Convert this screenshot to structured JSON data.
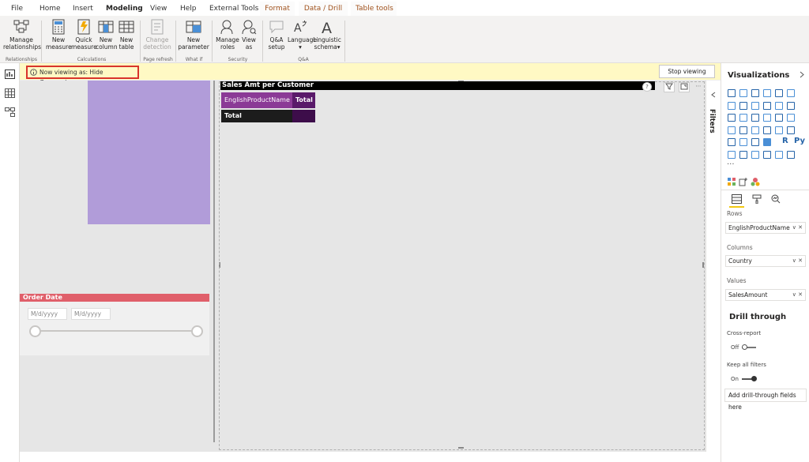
{
  "tabs": [
    {
      "label": "File",
      "active": false,
      "contextual": false
    },
    {
      "label": "Home",
      "active": false,
      "contextual": false
    },
    {
      "label": "Insert",
      "active": false,
      "contextual": false
    },
    {
      "label": "Modeling",
      "active": true,
      "contextual": false
    },
    {
      "label": "View",
      "active": false,
      "contextual": false
    },
    {
      "label": "Help",
      "active": false,
      "contextual": false
    },
    {
      "label": "External Tools",
      "active": false,
      "contextual": false
    },
    {
      "label": "Format",
      "active": false,
      "contextual": true
    },
    {
      "label": "Data / Drill",
      "active": false,
      "contextual": true
    },
    {
      "label": "Table tools",
      "active": false,
      "contextual": true
    }
  ],
  "ribbon": {
    "manage_relationships": "Manage relationships",
    "new_measure": "New measure",
    "quick_measure": "Quick measure",
    "new_column": "New column",
    "new_table": "New table",
    "change_detection": "Change detection",
    "new_parameter": "New parameter",
    "manage_roles": "Manage roles",
    "view_as": "View as",
    "qa_setup": "Q&A setup",
    "language": "Language",
    "linguistic_schema": "Linguistic schema",
    "groups": {
      "relationships": "Relationships",
      "calculations": "Calculations",
      "page_refresh": "Page refresh",
      "what_if": "What if",
      "security": "Security",
      "qa": "Q&A"
    }
  },
  "banner": {
    "viewing_text": "Now viewing as: Hide Geography",
    "stop_button": "Stop viewing"
  },
  "order_date": {
    "title": "Order Date",
    "from_placeholder": "M/d/yyyy",
    "to_placeholder": "M/d/yyyy"
  },
  "matrix": {
    "title": "Sales Amt per Customer",
    "row_header": "EnglishProductName",
    "col_header": "Total",
    "total_label": "Total"
  },
  "filters_pane": {
    "label": "Filters"
  },
  "visualizations": {
    "title": "Visualizations",
    "rows_label": "Rows",
    "rows_field": "EnglishProductName",
    "columns_label": "Columns",
    "columns_field": "Country",
    "values_label": "Values",
    "values_field": "SalesAmount",
    "drill_title": "Drill through",
    "cross_report_label": "Cross-report",
    "cross_report_state": "Off",
    "keep_filters_label": "Keep all filters",
    "keep_filters_state": "On",
    "add_fields": "Add drill-through fields here",
    "r_label": "R",
    "py_label": "Py",
    "more_label": "..."
  },
  "colors": {
    "accent_yellow": "#f2c811",
    "banner_bg": "#fff9c4",
    "banner_border": "#d9342b",
    "slicer_header": "#e05f6a",
    "matrix_header": "#8b3a96",
    "purple_shape": "#b19cd9"
  }
}
